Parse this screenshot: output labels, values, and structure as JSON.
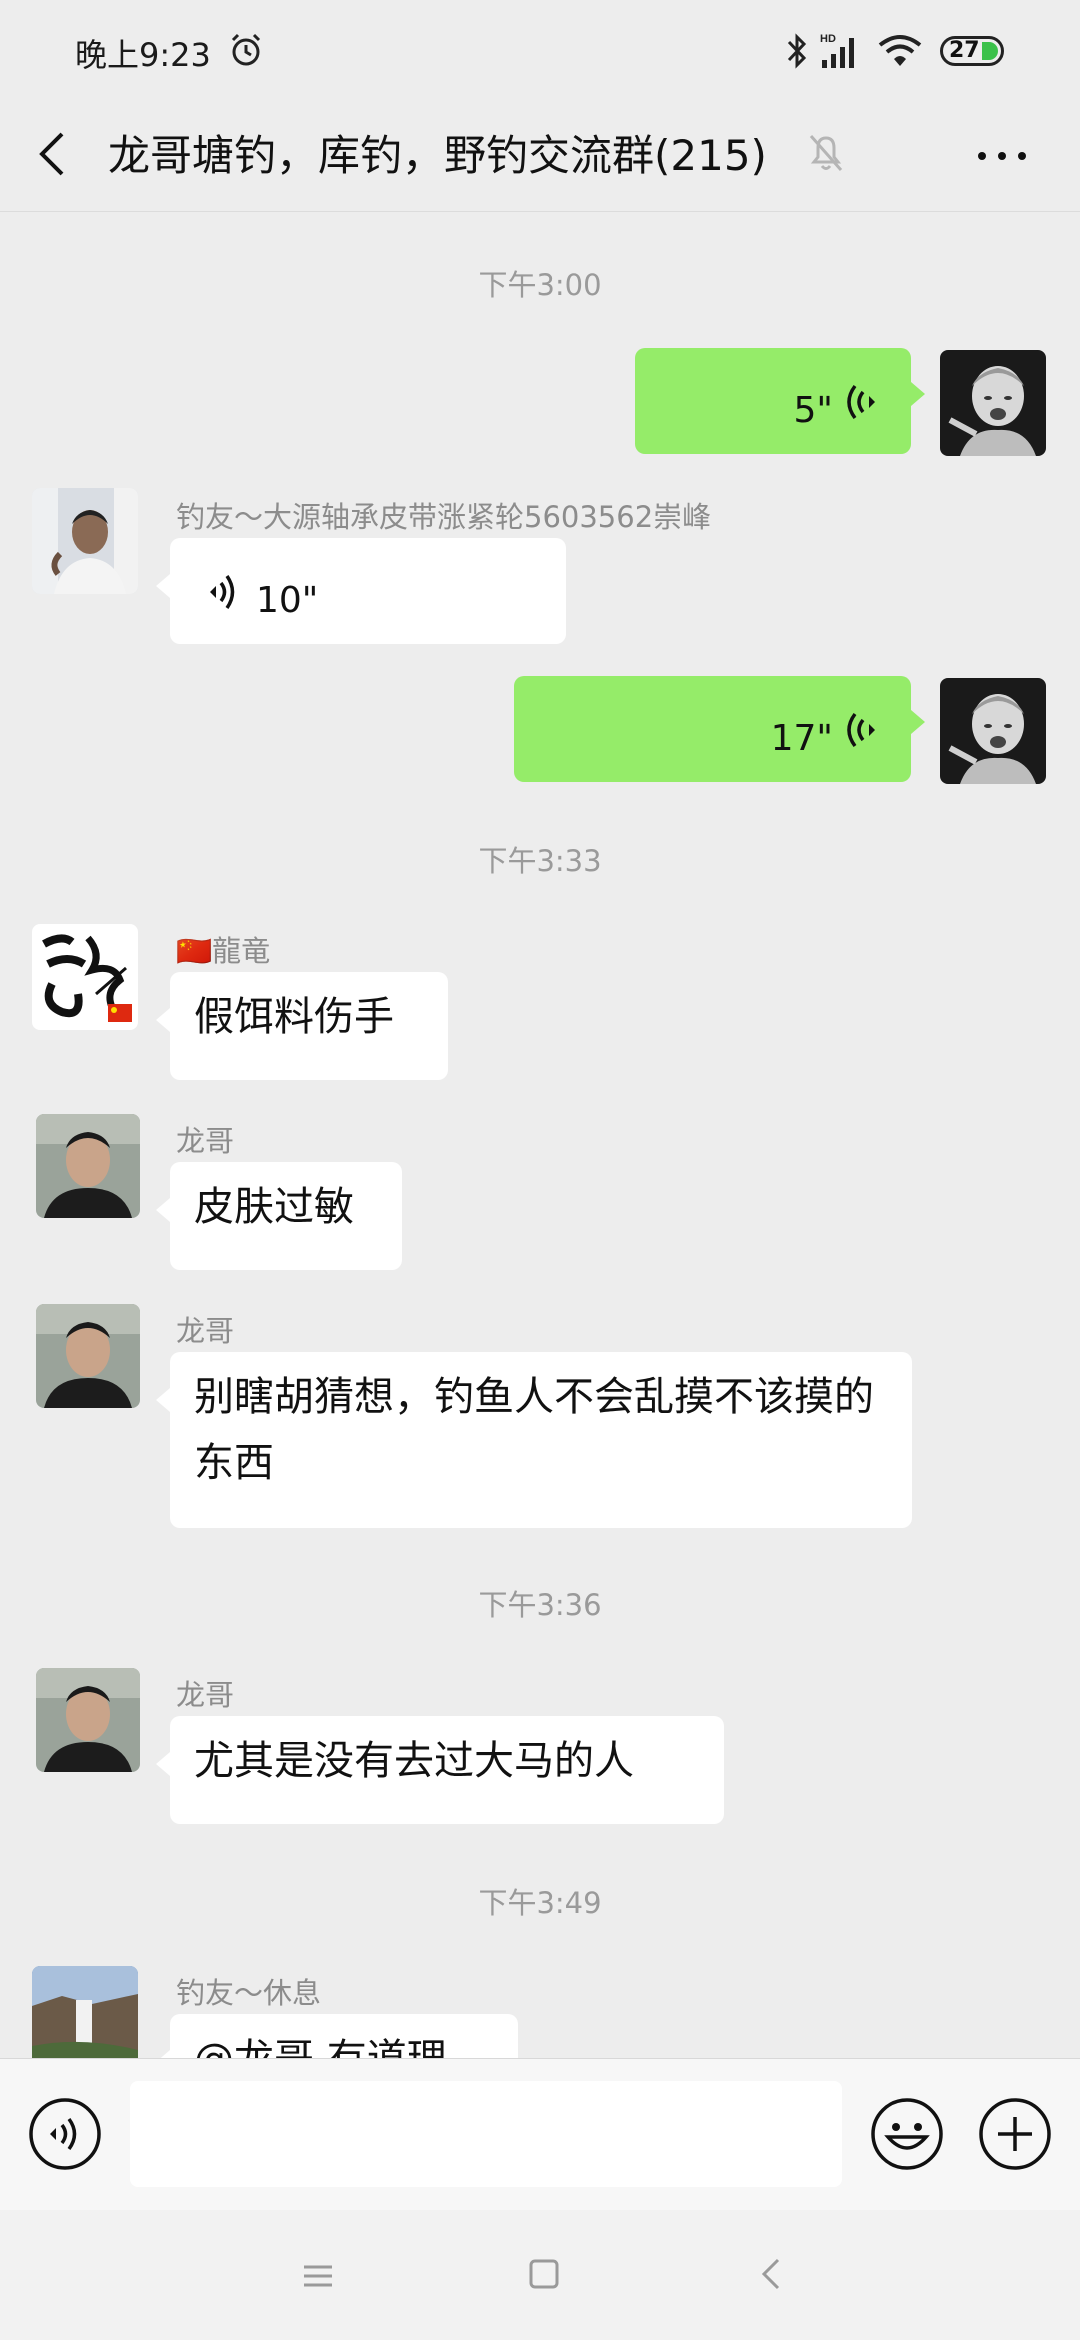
{
  "status_bar": {
    "time": "晚上9:23",
    "battery": "27",
    "network": "HD"
  },
  "header": {
    "title": "龙哥塘钓，库钓，野钓交流群(215)"
  },
  "messages": {
    "t1": "下午3:00",
    "m1": {
      "duration": "5\""
    },
    "m2": {
      "sender": "钓友～大源轴承皮带涨紧轮5603562崇峰",
      "duration": "10\""
    },
    "m3": {
      "duration": "17\""
    },
    "t2": "下午3:33",
    "m4": {
      "sender": "🇨🇳龍竜",
      "text": "假饵料伤手"
    },
    "m5": {
      "sender": "龙哥",
      "text": "皮肤过敏"
    },
    "m6": {
      "sender": "龙哥",
      "text": "别瞎胡猜想，钓鱼人不会乱摸不该摸的东西"
    },
    "t3": "下午3:36",
    "m7": {
      "sender": "龙哥",
      "text": "尤其是没有去过大马的人"
    },
    "t4": "下午3:49",
    "m8": {
      "sender": "钓友～休息",
      "text": "@龙哥 有道理"
    }
  },
  "input": {
    "value": ""
  }
}
